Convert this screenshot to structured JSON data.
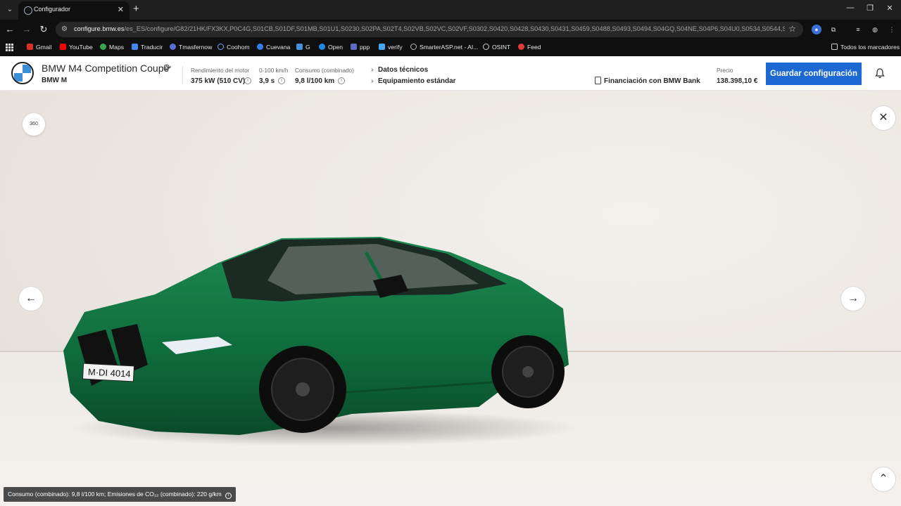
{
  "browser": {
    "tab_title": "Configurador",
    "url_host": "configure.bmw.es",
    "url_path": "/es_ES/configure/G82/21HK/FX3KX,P0C4G,S01CB,S01DF,S01MB,S01U1,S0230,S02PA,S02T4,S02VB,S02VC,S02VF,S0302,S0420,S0428,S0430,S0431,S0459,S0488,S0493,S0494,S04GQ,S04NE,S04P6,S04U0,S0534,S0544,S0548,S05AV,...",
    "bookmarks": [
      "Gmail",
      "YouTube",
      "Maps",
      "Traducir",
      "Tmasfernow",
      "Coohom",
      "Cuevana",
      "G",
      "Open",
      "ppp",
      "verify",
      "SmarterASP.net - AI...",
      "OSINT",
      "Feed"
    ],
    "all_bookmarks": "Todos los marcadores"
  },
  "header": {
    "model_name": "BMW M4 Competition Coupé",
    "brand_line": "BMW M",
    "specs": [
      {
        "label": "Rendimiento del motor",
        "value": "375 kW (510 CV)"
      },
      {
        "label": "0-100 km/h",
        "value": "3,9 s"
      },
      {
        "label": "Consumo (combinado)",
        "value": "9,8 l/100 km"
      }
    ],
    "links": [
      "Datos técnicos",
      "Equipamiento estándar"
    ],
    "financing": "Financiación con BMW Bank",
    "price_label": "Precio",
    "price_value": "138.398,10 €",
    "save_button": "Guardar configuración"
  },
  "stage": {
    "view_360": "360",
    "plate": "M·DI 4014",
    "car_color": "#0f6b3c",
    "consumption_note": "Consumo (combinado): 9,8 l/100 km; Emisiones de CO₂₂ (combinado): 220 g/km"
  },
  "colors": {
    "accent": "#1c69d4",
    "chrome_bg": "#0f0f0f"
  }
}
